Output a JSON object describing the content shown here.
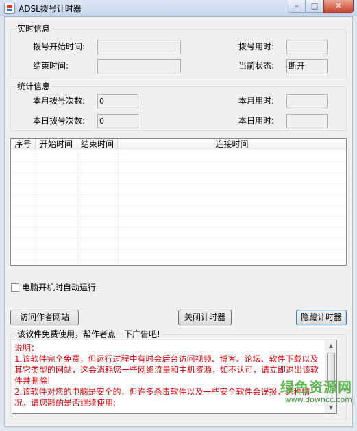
{
  "window": {
    "title": "ADSL拨号计时器",
    "minimize_glyph": "–",
    "maximize_glyph": "□",
    "close_glyph": "✕"
  },
  "realtime": {
    "title": "实时信息",
    "dial_start_label": "拨号开始时间:",
    "dial_start_value": "",
    "end_time_label": "结束时间:",
    "end_time_value": "",
    "dial_duration_label": "拨号用时:",
    "dial_duration_value": "",
    "status_label": "当前状态:",
    "status_value": "断开"
  },
  "stats": {
    "title": "统计信息",
    "month_count_label": "本月拨号次数:",
    "month_count_value": "0",
    "day_count_label": "本日拨号次数:",
    "day_count_value": "0",
    "month_time_label": "本月用时:",
    "month_time_value": "",
    "day_time_label": "本日用时:",
    "day_time_value": ""
  },
  "table": {
    "columns": [
      "序号",
      "开始时间",
      "结束时间",
      "连接时间"
    ],
    "rows": []
  },
  "autorun": {
    "label": "电脑开机时自动运行",
    "checked": false
  },
  "buttons": {
    "visit_site": "访问作者网站",
    "close_timer": "关闭计时器",
    "hide_timer": "隐藏计时器"
  },
  "notice": {
    "title": "该软件免费使用，帮作者点一下广告吧!",
    "text": "说明：\n1.该软件完全免费，但运行过程中有时会后台访问视频、博客、论坛、软件下载以及其它类型的网站，这会消耗您一些网络流量和主机资源，如不认可，请立即退出该软件并删除!\n2.该软件对您的电脑是安全的，但许多杀毒软件以及一些安全软件会误报，这种情况，请您斟酌是否继续使用;"
  },
  "watermark": {
    "text": "绿色资源网",
    "url": "www.downcc.com"
  },
  "icons": {
    "app": "adsl-app-icon",
    "scroll_up": "▲",
    "scroll_down": "▼"
  }
}
